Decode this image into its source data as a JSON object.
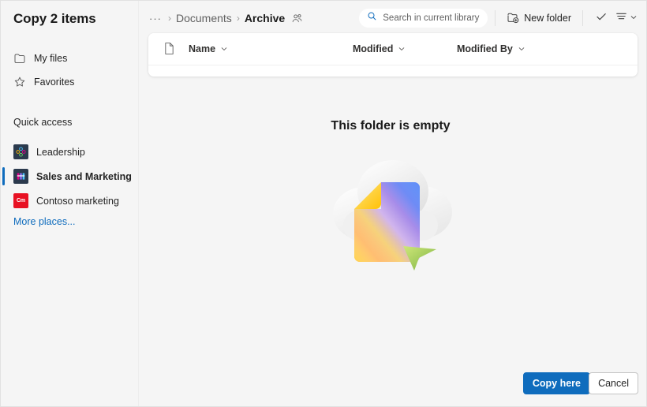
{
  "dialog": {
    "title": "Copy 2 items"
  },
  "sidebar": {
    "nav": [
      {
        "label": "My files",
        "icon": "folder-icon"
      },
      {
        "label": "Favorites",
        "icon": "star-icon"
      }
    ],
    "section_label": "Quick access",
    "quick_access": [
      {
        "label": "Leadership",
        "icon": "site-icon-leadership",
        "selected": false
      },
      {
        "label": "Sales and Marketing",
        "icon": "site-icon-sales",
        "selected": true
      },
      {
        "label": "Contoso marketing",
        "icon": "site-icon-contoso",
        "tile_text": "Cm",
        "selected": false
      }
    ],
    "more_places_label": "More places..."
  },
  "breadcrumb": {
    "overflow": "···",
    "separator": "›",
    "items": [
      {
        "label": "Documents",
        "current": false
      },
      {
        "label": "Archive",
        "current": true
      }
    ],
    "shared_icon": "people-shared-icon"
  },
  "toolbar": {
    "search_placeholder": "Search in current library",
    "search_value": "",
    "search_icon": "search-icon",
    "new_folder_label": "New folder",
    "new_folder_icon": "folder-add-icon",
    "select_icon": "checkmark-icon",
    "sort_icon": "sort-lines-icon",
    "sort_chevron_icon": "chevron-down-icon"
  },
  "file_list": {
    "type_icon": "document-icon",
    "columns": [
      {
        "label": "Name",
        "chevron": "chevron-down-icon"
      },
      {
        "label": "Modified",
        "chevron": "chevron-down-icon"
      },
      {
        "label": "Modified By",
        "chevron": "chevron-down-icon"
      }
    ],
    "rows": []
  },
  "empty_state": {
    "title": "This folder is empty",
    "illustration": "cloud-document-cursor-illustration"
  },
  "footer": {
    "primary_label": "Copy here",
    "secondary_label": "Cancel"
  },
  "colors": {
    "accent": "#0f6cbd",
    "link": "#0f6cbd",
    "selected_indicator": "#0f6cbd",
    "contoso_tile": "#e81123",
    "surface": "#ffffff",
    "background": "#f5f5f5"
  }
}
